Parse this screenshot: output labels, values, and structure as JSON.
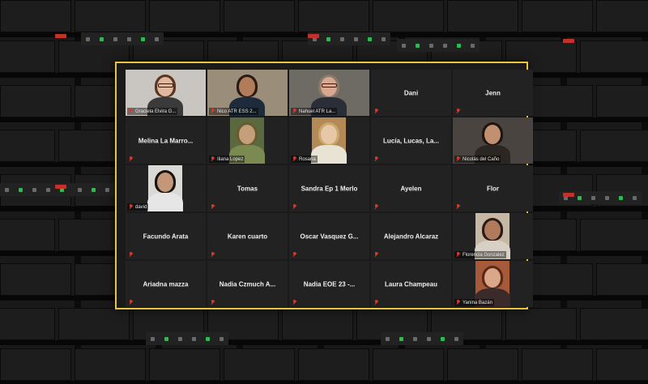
{
  "colors": {
    "active_speaker_border": "#e8c53a",
    "tile_bg": "#222222",
    "muted_icon": "#d53a2f",
    "end_button": "#c2322a",
    "unmute_green": "#2dbb4e"
  },
  "gallery": {
    "participants": [
      {
        "name": "Graciela Elvira G...",
        "video": true,
        "muted": true
      },
      {
        "name": "Nico ATR ESS 2...",
        "video": true,
        "muted": true,
        "active_speaker": true
      },
      {
        "name": "Nahuel ATR La...",
        "video": true,
        "muted": true
      },
      {
        "name": "Dani",
        "video": false,
        "muted": true
      },
      {
        "name": "Jenn",
        "video": false,
        "muted": true
      },
      {
        "name": "Melina La Marro...",
        "video": false,
        "muted": true
      },
      {
        "name": "Iliana Lopez",
        "video": true,
        "muted": true
      },
      {
        "name": "Rosana",
        "video": true,
        "muted": true
      },
      {
        "name": "Lucía, Lucas, La...",
        "video": false,
        "muted": true
      },
      {
        "name": "Nicolás del Caño",
        "video": true,
        "muted": true
      },
      {
        "name": "david",
        "video": true,
        "muted": true
      },
      {
        "name": "Tomas",
        "video": false,
        "muted": true
      },
      {
        "name": "Sandra Ep 1 Merlo",
        "video": false,
        "muted": true
      },
      {
        "name": "Ayelen",
        "video": false,
        "muted": true
      },
      {
        "name": "Flor",
        "video": false,
        "muted": true
      },
      {
        "name": "Facundo Arata",
        "video": false,
        "muted": true
      },
      {
        "name": "Karen cuarto",
        "video": false,
        "muted": true
      },
      {
        "name": "Oscar Vasquez G...",
        "video": false,
        "muted": true
      },
      {
        "name": "Alejandro Alcaraz",
        "video": false,
        "muted": true
      },
      {
        "name": "Florencia Gonzalez",
        "video": true,
        "muted": true
      },
      {
        "name": "Ariadna mazza",
        "video": false,
        "muted": true
      },
      {
        "name": "Nadia Czmuch A...",
        "video": false,
        "muted": true
      },
      {
        "name": "Nadia EOE 23 -...",
        "video": false,
        "muted": true
      },
      {
        "name": "Laura Champeau",
        "video": false,
        "muted": true
      },
      {
        "name": "Yanina Bazán",
        "video": true,
        "muted": true
      }
    ]
  }
}
